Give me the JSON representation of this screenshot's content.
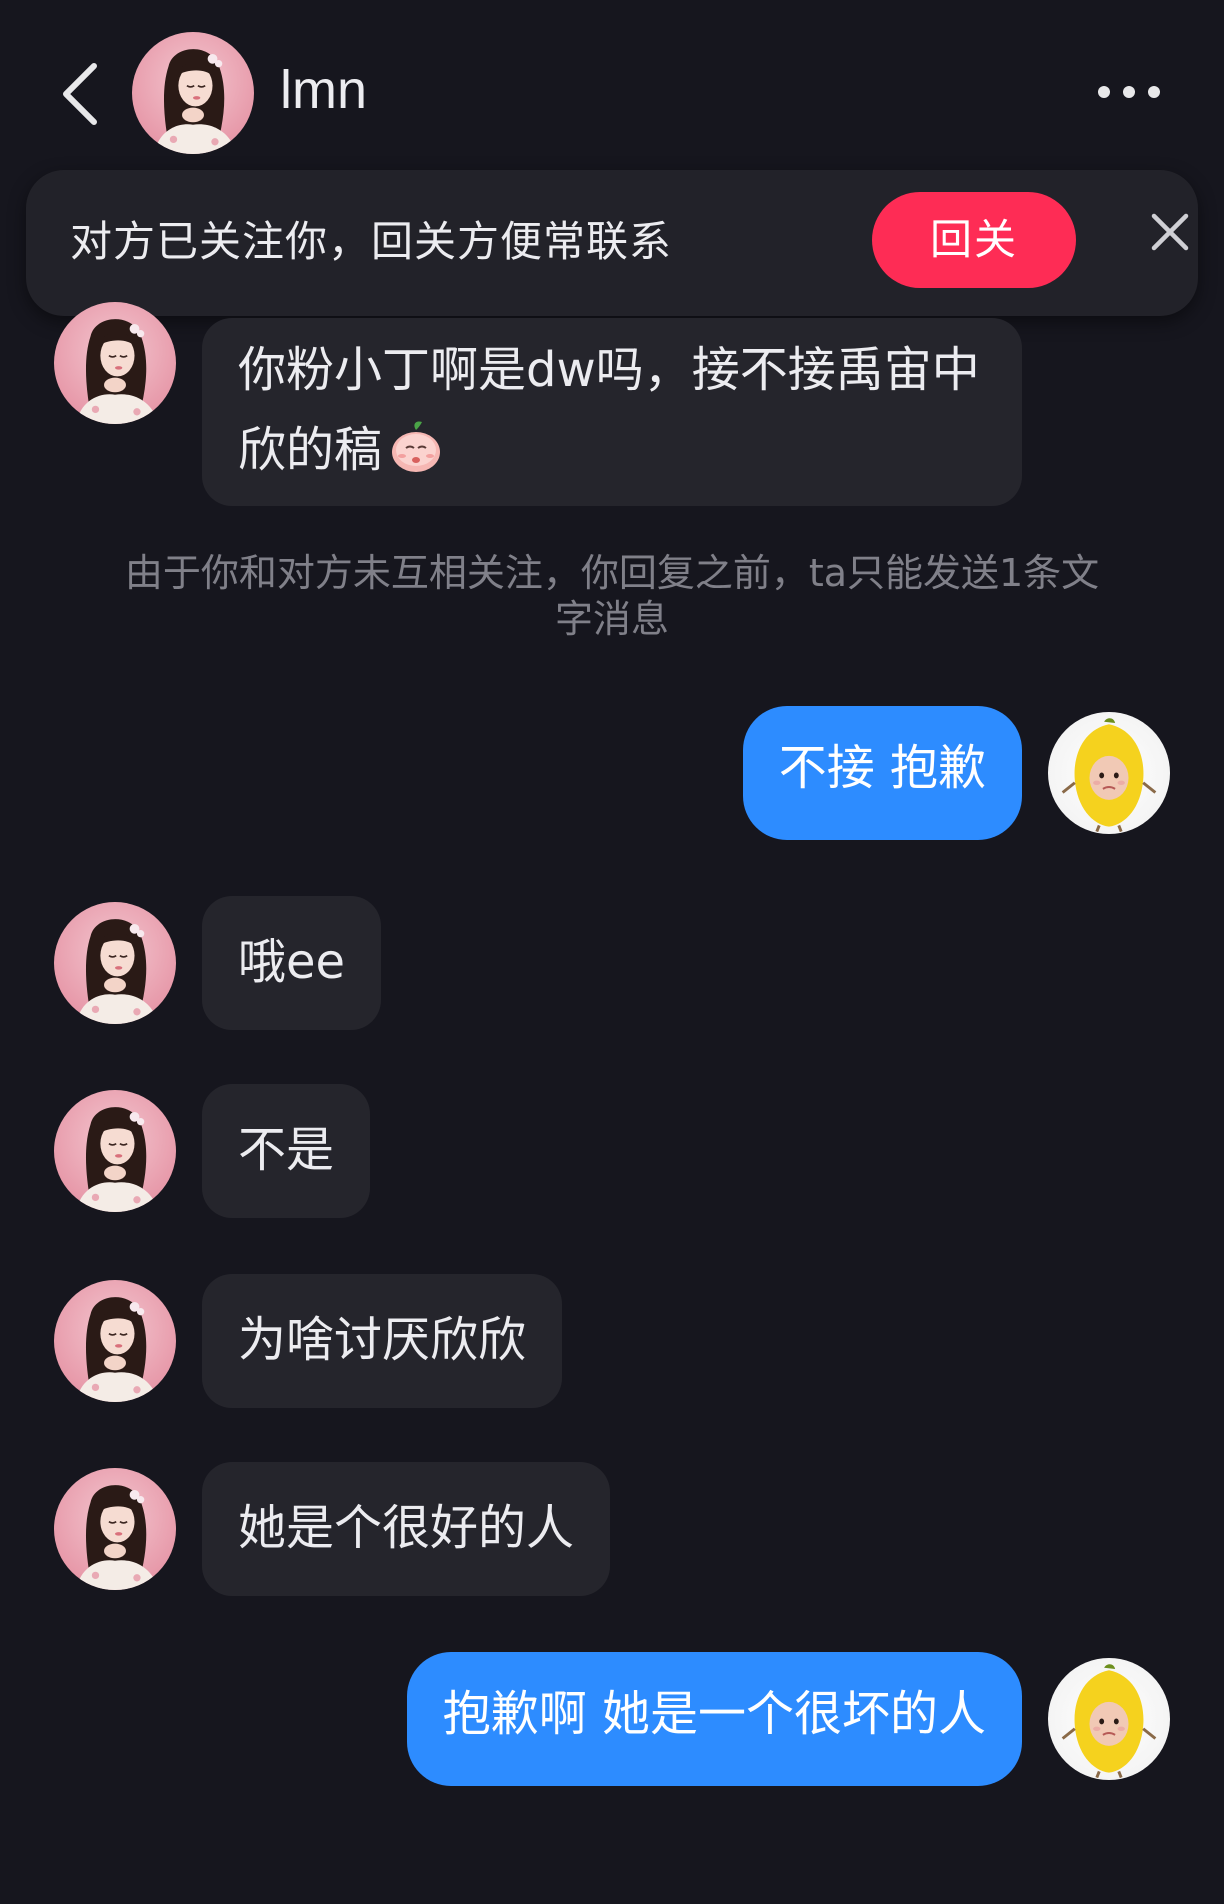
{
  "header": {
    "contact_name": "lmn"
  },
  "banner": {
    "text": "对方已关注你，回关方便常联系",
    "follow_back_label": "回关"
  },
  "system_note": "由于你和对方未互相关注，你回复之前，ta只能发送1条文字消息",
  "messages": [
    {
      "side": "in",
      "text": "你粉小丁啊是dw吗，接不接禹宙中欣的稿"
    },
    {
      "side": "out",
      "text": "不接 抱歉"
    },
    {
      "side": "in",
      "text": "哦ee"
    },
    {
      "side": "in",
      "text": "不是"
    },
    {
      "side": "in",
      "text": "为啥讨厌欣欣"
    },
    {
      "side": "in",
      "text": "她是个很好的人"
    },
    {
      "side": "out",
      "text": "抱歉啊 她是一个很坏的人"
    }
  ],
  "colors": {
    "background": "#16161e",
    "incoming_bubble": "#25252c",
    "outgoing_bubble": "#2d8cff",
    "follow_button": "#fe2c55"
  },
  "icons": {
    "back": "chevron-left-icon",
    "more": "more-horizontal-icon",
    "close": "close-icon",
    "sticker": "peach-sticker-icon"
  }
}
